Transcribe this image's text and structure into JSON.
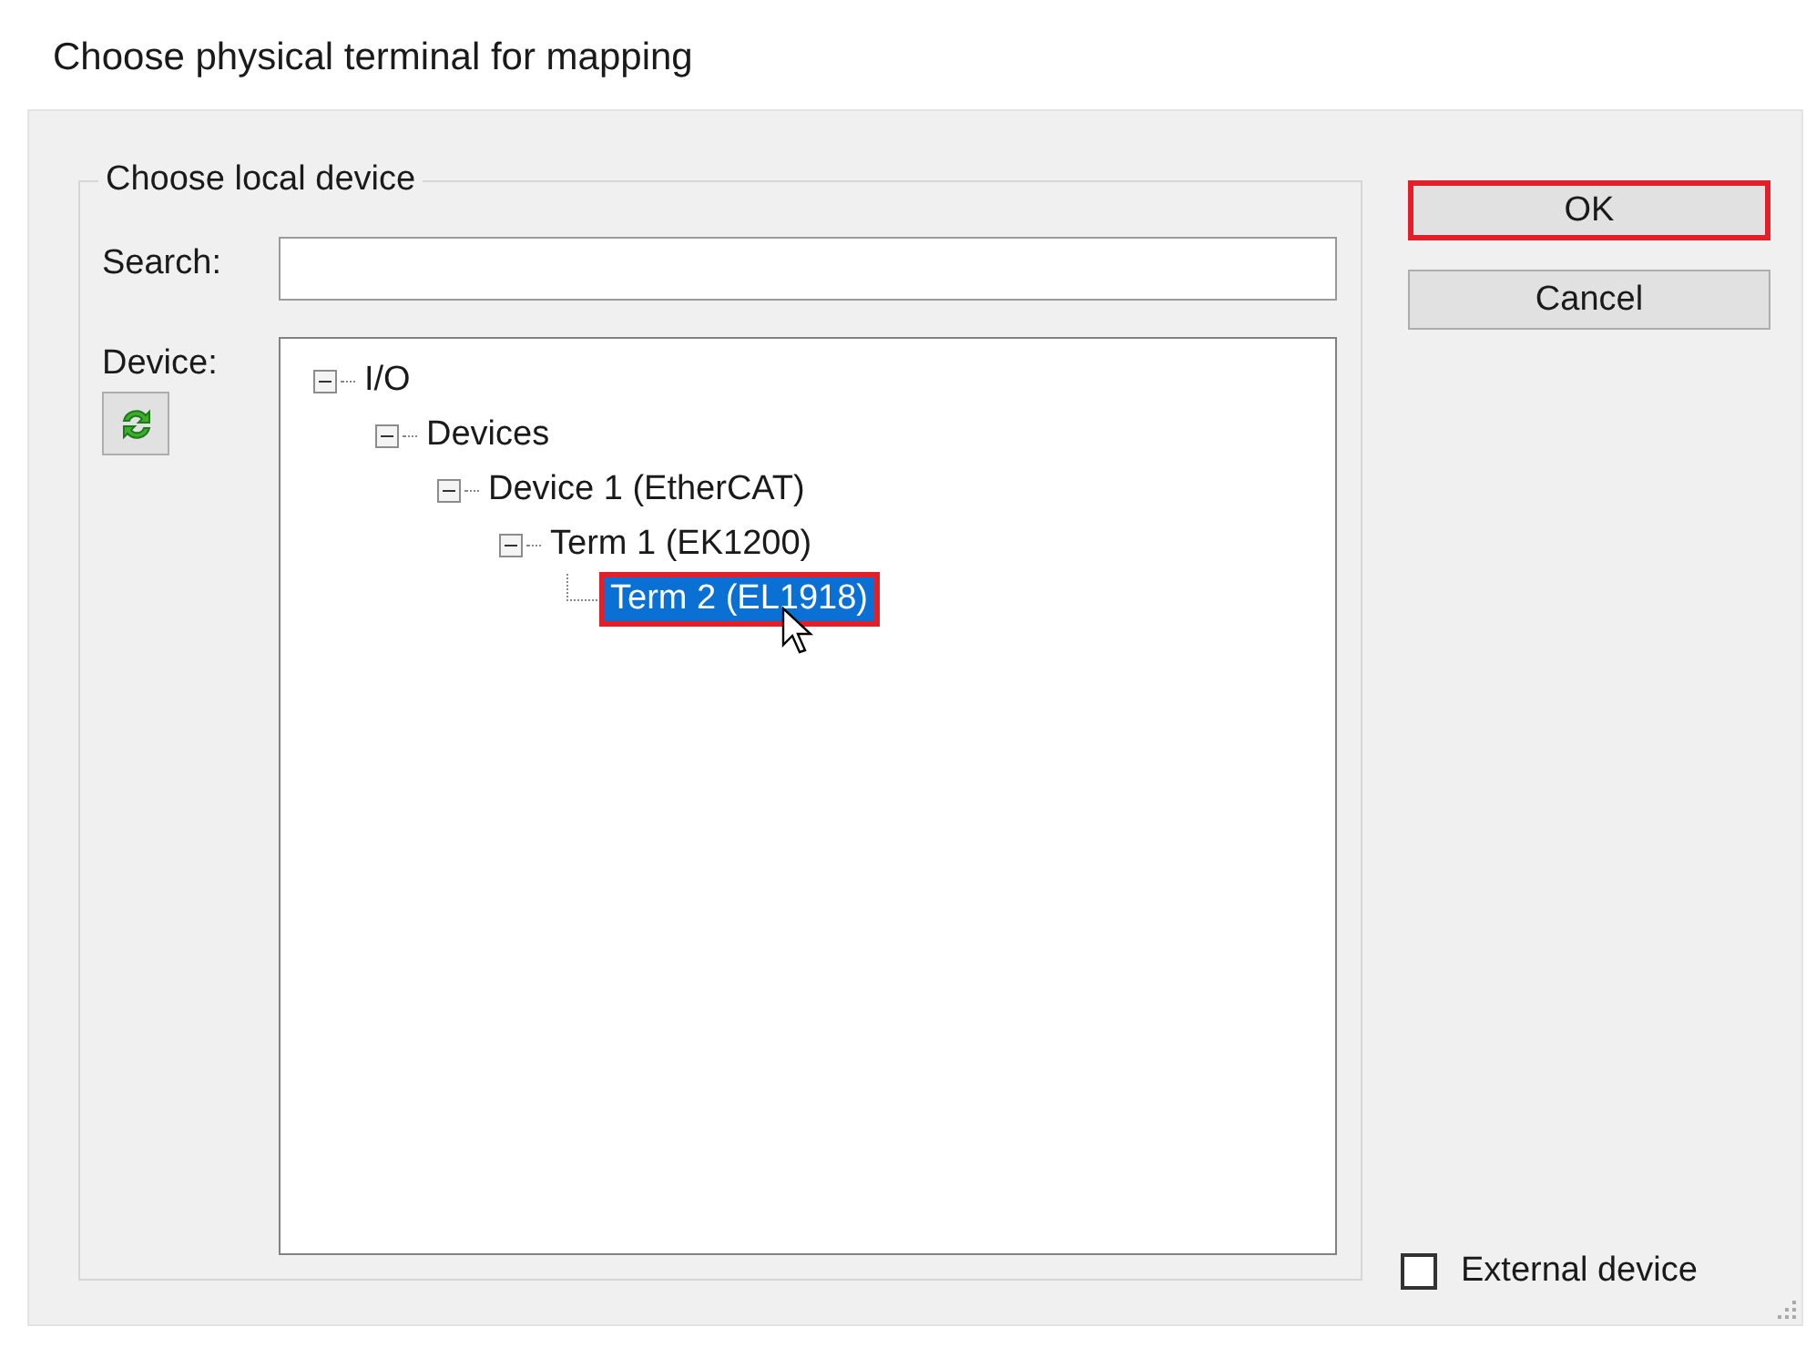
{
  "window": {
    "title": "Choose physical terminal for mapping"
  },
  "group": {
    "title": "Choose local device"
  },
  "search": {
    "label": "Search:"
  },
  "device": {
    "label": "Device:"
  },
  "tree": [
    {
      "label": "I/O",
      "expanded": true,
      "selected": false,
      "highlighted": false,
      "children": [
        {
          "label": "Devices",
          "expanded": true,
          "selected": false,
          "highlighted": false,
          "children": [
            {
              "label": "Device 1 (EtherCAT)",
              "expanded": true,
              "selected": false,
              "highlighted": false,
              "children": [
                {
                  "label": "Term 1 (EK1200)",
                  "expanded": true,
                  "selected": false,
                  "highlighted": false,
                  "children": [
                    {
                      "label": "Term 2 (EL1918)",
                      "selected": true,
                      "highlighted": true
                    }
                  ]
                }
              ]
            }
          ]
        }
      ]
    }
  ],
  "buttons": [
    {
      "label": "OK",
      "highlighted": true
    },
    {
      "label": "Cancel",
      "highlighted": false
    }
  ],
  "external_device": {
    "label": "External device",
    "checked": false
  }
}
